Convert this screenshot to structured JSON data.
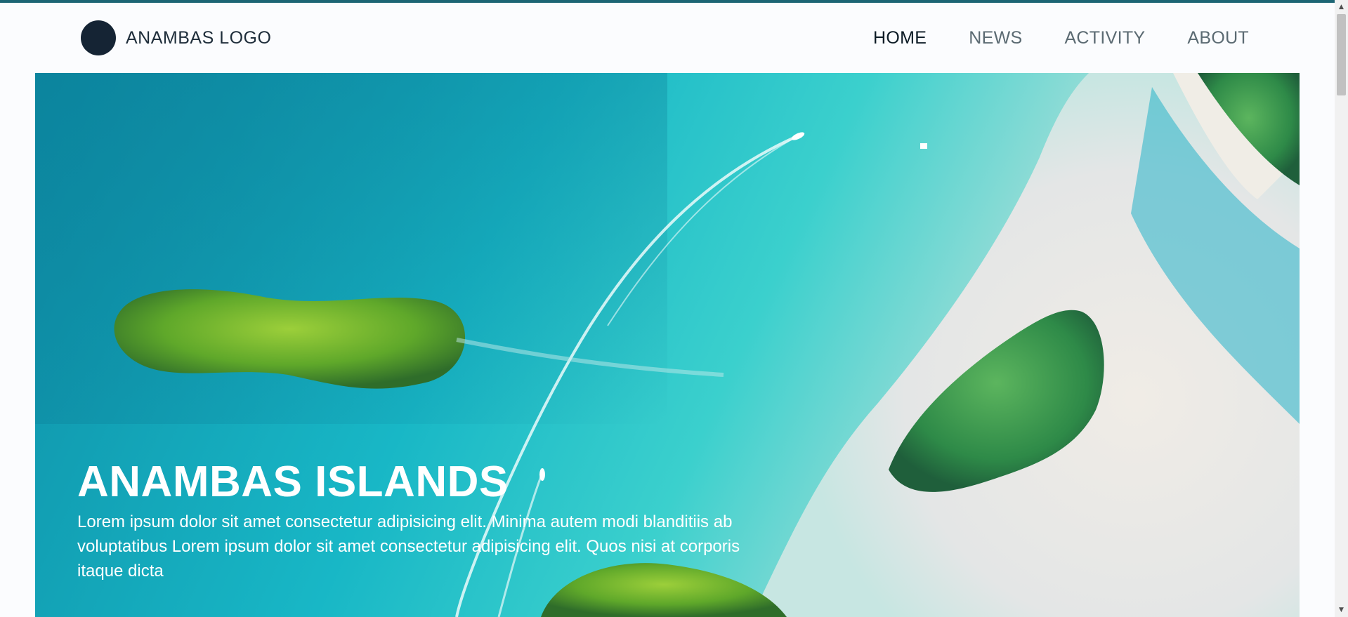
{
  "header": {
    "logo_text": "ANAMBAS LOGO",
    "nav": [
      {
        "label": "HOME",
        "active": true
      },
      {
        "label": "NEWS",
        "active": false
      },
      {
        "label": "ACTIVITY",
        "active": false
      },
      {
        "label": "ABOUT",
        "active": false
      }
    ]
  },
  "hero": {
    "title": "ANAMBAS ISLANDS",
    "description": "Lorem ipsum dolor sit amet consectetur adipisicing elit. Minima autem modi blanditiis ab voluptatibus Lorem ipsum dolor sit amet consectetur adipisicing elit. Quos nisi at corporis itaque dicta"
  },
  "scrollbar": {
    "up_icon": "▲",
    "down_icon": "▼",
    "position_fraction": 0.0
  },
  "colors": {
    "accent_bar": "#1c6574",
    "logo_circle": "#152434",
    "nav_active": "#0c1b25",
    "nav_inactive": "#5b6a72",
    "hero_text": "#ffffff"
  }
}
